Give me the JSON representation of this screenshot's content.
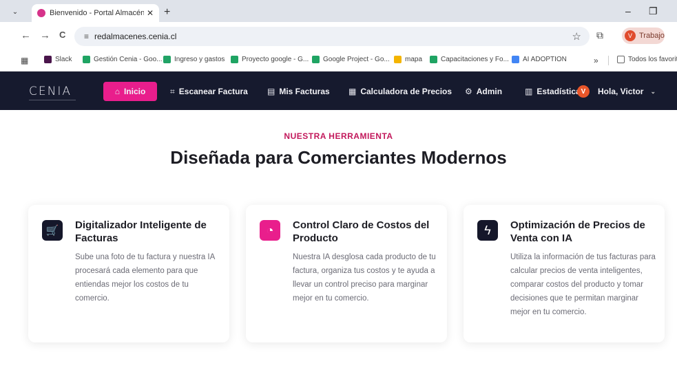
{
  "browser": {
    "tab_title": "Bienvenido - Portal Almacén Cl",
    "tab_close": "✕",
    "new_tab": "+",
    "tab_list": "⌄",
    "minimize": "–",
    "restore": "❐",
    "back": "←",
    "forward": "→",
    "reload": "C",
    "site_info": "≡",
    "url": "redalmacenes.cenia.cl",
    "star": "☆",
    "extensions": "⧉",
    "profile_initial": "V",
    "profile_label": "Trabajo",
    "bookmarks": [
      {
        "label": "Slack",
        "color": "#4a154b"
      },
      {
        "label": "Gestión Cenia - Goo...",
        "color": "#1fa463"
      },
      {
        "label": "Ingreso y gastos",
        "color": "#21a366"
      },
      {
        "label": "Proyecto google - G...",
        "color": "#1fa463"
      },
      {
        "label": "Google Project - Go...",
        "color": "#1fa463"
      },
      {
        "label": "mapa",
        "color": "#f4b400"
      },
      {
        "label": "Capacitaciones y Fo...",
        "color": "#1fa463"
      },
      {
        "label": "AI ADOPTION",
        "color": "#4285f4"
      }
    ],
    "bookmarks_more": "»",
    "all_bookmarks": "Todos los favoritos",
    "apps_icon": "▦"
  },
  "app": {
    "logo": "CENIA",
    "nav": {
      "inicio": "Inicio",
      "escanear": "Escanear Factura",
      "mis_facturas": "Mis Facturas",
      "calculadora": "Calculadora de Precios",
      "admin": "Admin",
      "estadisticas": "Estadísticas",
      "user_badge": "V",
      "greeting": "Hola, Victor"
    },
    "icons": {
      "inicio": "⌂",
      "escanear": "⌗",
      "mis_facturas": "▤",
      "calculadora": "▦",
      "admin": "⚙",
      "estadisticas": "▥"
    }
  },
  "main": {
    "eyebrow": "NUESTRA HERRAMIENTA",
    "headline": "Diseñada para Comerciantes Modernos",
    "cards": [
      {
        "icon": "cart-icon",
        "glyph": "🛒",
        "icon_color": "#15172a",
        "title": "Digitalizador Inteligente de Facturas",
        "body": "Sube una foto de tu factura y nuestra IA procesará cada elemento para que entiendas mejor los costos de tu comercio."
      },
      {
        "icon": "pie-chart-icon",
        "glyph": "◔",
        "icon_color": "#e91e8c",
        "title": "Control Claro de Costos del Producto",
        "body": "Nuestra IA desglosa cada producto de tu factura, organiza tus costos y te ayuda a llevar un control preciso para marginar mejor en tu comercio."
      },
      {
        "icon": "lightning-icon",
        "glyph": "ϟ",
        "icon_color": "#15172a",
        "title": "Optimización de Precios de Venta con IA",
        "body": "Utiliza la información de tus facturas para calcular precios de venta inteligentes, comparar costos del producto y tomar decisiones que te permitan marginar mejor en tu comercio."
      }
    ]
  }
}
